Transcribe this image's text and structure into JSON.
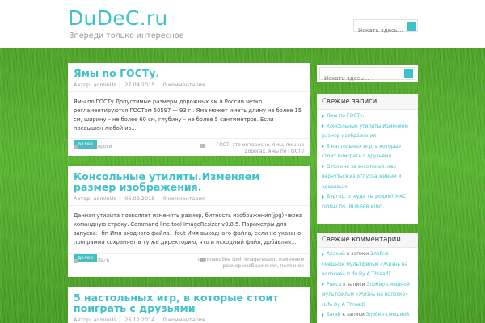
{
  "site": {
    "title": "DuDeC.ru",
    "description": "Впереди только интересное",
    "search_placeholder": "Искать здесь...",
    "accent_color": "#3fc2c7"
  },
  "posts": [
    {
      "title": "Ямы по ГОСТу.",
      "author": "Автор: adminUs",
      "date": "27.04.2015",
      "comments": "0 комментария",
      "excerpt": "Ямы по ГОСТу Допустимые размеры дорожных ям в России четко регламентируются ГОСТом 50597 — 93 г.. Яма может иметь длину не более 15 см, ширину – не более 60 см, глубину – не более 5 сантиметров. Если превышен любой из…",
      "more_label": "далее",
      "category": "ПРО Дороги",
      "tags": "ГОСТ, это интересно, ямы, ямы на дорогах, ямы по ГОСТу"
    },
    {
      "title": "Консольные утилиты.Изменяем размер изображения.",
      "author": "Автор: adminUs",
      "date": "06.02.2015",
      "comments": "0 комментария",
      "excerpt": "Данная утилита позволяет изменять размер, битность изображения(jpg) через командную строку. Command line tool ImageResizer v0.8.5. Параметры для запуска: -fin Имя входного файла. -fout Имя выходного файла, если не указано программа сохраняет в ту же директорию, что и исходный файл, добавляя…",
      "more_label": "далее",
      "category": "ПРО HiTech",
      "tags": "commandline tool, imageresizer, изменяем размер изображения, полезное"
    },
    {
      "title": "5 настольных игр, в которые стоит поиграть с друзьями",
      "author": "Автор: adminUs",
      "date": "26.12.2014",
      "comments": "0 комментария"
    }
  ],
  "sidebar": {
    "search_placeholder": "Искать здесь...",
    "recent_posts": {
      "title": "Свежие записи",
      "items": [
        "Ямы по ГОСТу.",
        "Консольные утилиты.Изменяем размер изображения.",
        "5 настольных игр, в которые стоит поиграть с друзьями",
        "В погоне за экзотикой: как вернуться из отпуска живым и здоровым",
        "Бургер, откуда ты родом? MAC DONALDS, BURGER KING"
      ]
    },
    "recent_comments": {
      "title": "Свежие комментарии",
      "items": [
        {
          "author": "Акакий",
          "prefix": "к записи",
          "post": "Злобно-смешной мультфильм «Жизнь на волоске» (Life By A Thread)"
        },
        {
          "author": "Раиса",
          "prefix": "к записи",
          "post": "Злобно-смешной мультфильм «Жизнь на волоске» (Life By A Thread)"
        },
        {
          "author": "Sarah",
          "prefix": "к записи",
          "post": "Злобно-смешной"
        }
      ]
    }
  }
}
